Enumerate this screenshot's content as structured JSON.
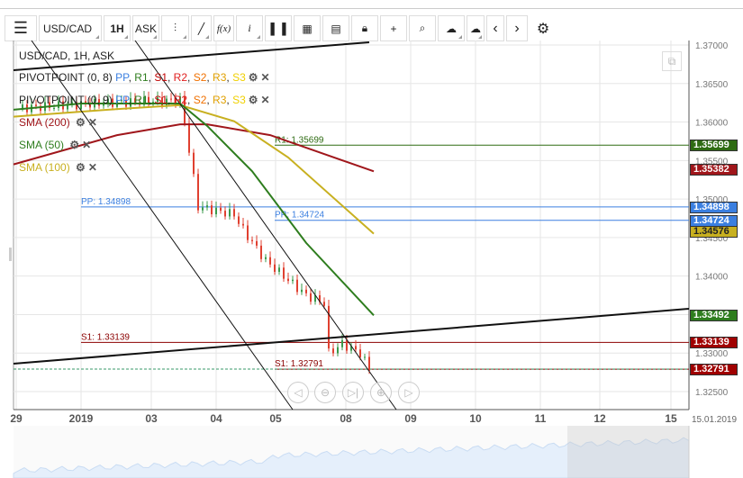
{
  "toolbar": {
    "symbol": "USD/CAD",
    "interval": "1H",
    "price_type": "ASK",
    "fx_label": "f(x)",
    "info_label": "i"
  },
  "legend": {
    "title": "USD/CAD, 1H, ASK",
    "pivots": [
      {
        "name": "PIVOTPOINT (0, 8)"
      },
      {
        "name": "PIVOTPOINT (0, 9)"
      }
    ],
    "pivot_parts": [
      {
        "t": "PP",
        "c": "#3b7fe0"
      },
      {
        "t": "R1",
        "c": "#2e7d1e"
      },
      {
        "t": "S1",
        "c": "#c00000"
      },
      {
        "t": "R2",
        "c": "#e02020"
      },
      {
        "t": "S2",
        "c": "#f07000"
      },
      {
        "t": "R3",
        "c": "#e0a000"
      },
      {
        "t": "S3",
        "c": "#f0d000"
      }
    ],
    "smas": [
      {
        "name": "SMA (200)",
        "color": "#a0161b"
      },
      {
        "name": "SMA (50)",
        "color": "#2e7d1e"
      },
      {
        "name": "SMA (100)",
        "color": "#c8b020"
      }
    ]
  },
  "price_axis": {
    "ticks": [
      "1.37000",
      "1.36500",
      "1.36000",
      "1.35500",
      "1.35000",
      "1.34500",
      "1.34000",
      "1.33500",
      "1.33000",
      "1.32500"
    ],
    "tick_values": [
      1.37,
      1.365,
      1.36,
      1.355,
      1.35,
      1.345,
      1.34,
      1.335,
      1.33,
      1.325
    ]
  },
  "time_axis": {
    "labels": [
      "29",
      "2019",
      "03",
      "04",
      "05",
      "08",
      "09",
      "10",
      "11",
      "12",
      "15"
    ],
    "date": "15.01.2019"
  },
  "levels": [
    {
      "label": "R1: 1.35699",
      "value": 1.35699,
      "color": "#2e6b12",
      "start": "late"
    },
    {
      "label": "PP: 1.34898",
      "value": 1.34898,
      "color": "#3b7fe0",
      "start": "early"
    },
    {
      "label": "PP: 1.34724",
      "value": 1.34724,
      "color": "#3b7fe0",
      "start": "late"
    },
    {
      "label": "S1: 1.33139",
      "value": 1.33139,
      "color": "#8b0000",
      "start": "early"
    },
    {
      "label": "S1: 1.32791",
      "value": 1.32791,
      "color": "#8b0000",
      "start": "late"
    }
  ],
  "tags": [
    {
      "text": "1.35699",
      "value": 1.35699,
      "bg": "#2e6b12"
    },
    {
      "text": "1.35382",
      "value": 1.35382,
      "bg": "#a0161b"
    },
    {
      "text": "1.34898",
      "value": 1.34898,
      "bg": "#3b7fe0"
    },
    {
      "text": "1.34724",
      "value": 1.34724,
      "bg": "#3b7fe0"
    },
    {
      "text": "1.34576",
      "value": 1.34576,
      "bg": "#c8b020",
      "fg": "#222"
    },
    {
      "text": "1.33492",
      "value": 1.33492,
      "bg": "#2e7d1e"
    },
    {
      "text": "1.33139",
      "value": 1.33139,
      "bg": "#a00000"
    },
    {
      "text": "1.32791",
      "value": 1.32791,
      "bg": "#a00000"
    }
  ],
  "price_path": [
    [
      0,
      1.3618
    ],
    [
      20,
      1.3625
    ],
    [
      36,
      1.3628
    ],
    [
      37,
      1.36
    ],
    [
      40,
      1.349
    ],
    [
      48,
      1.348
    ],
    [
      50,
      1.346
    ],
    [
      55,
      1.342
    ],
    [
      60,
      1.3395
    ],
    [
      64,
      1.3375
    ],
    [
      68,
      1.3365
    ],
    [
      69,
      1.33
    ],
    [
      72,
      1.3312
    ],
    [
      76,
      1.33
    ],
    [
      78,
      1.3279
    ]
  ],
  "sma_series": {
    "sma200": [
      [
        -1,
        1.3545
      ],
      [
        22,
        1.3583
      ],
      [
        36,
        1.3597
      ],
      [
        42,
        1.3597
      ],
      [
        56,
        1.3583
      ],
      [
        79,
        1.3536
      ]
    ],
    "sma100": [
      [
        -1,
        1.3607
      ],
      [
        20,
        1.3616
      ],
      [
        36,
        1.3622
      ],
      [
        48,
        1.3601
      ],
      [
        60,
        1.3554
      ],
      [
        79,
        1.3455
      ]
    ],
    "sma50": [
      [
        -1,
        1.3616
      ],
      [
        14,
        1.3624
      ],
      [
        36,
        1.3624
      ],
      [
        42,
        1.3595
      ],
      [
        52,
        1.3536
      ],
      [
        64,
        1.3443
      ],
      [
        79,
        1.3349
      ]
    ]
  }
}
